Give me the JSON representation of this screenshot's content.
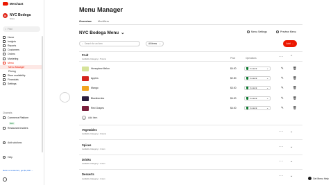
{
  "brand": {
    "name": "Merchant"
  },
  "store": {
    "name": "NYC Bodega",
    "sub": "Store",
    "initials": "N"
  },
  "sidebar": {
    "search_placeholder": "Find",
    "items": [
      {
        "label": "Home"
      },
      {
        "label": "Insights"
      },
      {
        "label": "Reports"
      },
      {
        "label": "Customers"
      },
      {
        "label": "Orders"
      },
      {
        "label": "Marketing"
      },
      {
        "label": "Menu"
      },
      {
        "label": "Menu Manager"
      },
      {
        "label": "Pricing"
      },
      {
        "label": "Store availability"
      },
      {
        "label": "Financials"
      },
      {
        "label": "Settings"
      }
    ],
    "section_label": "Channels",
    "channels": [
      {
        "label": "Commerce Platform",
        "badge": "New"
      },
      {
        "label": "Restaurant Insiders"
      }
    ],
    "add_solutions": "Add solutions",
    "help": "Help",
    "refer": "Refer a restaurant, get $1,000 →"
  },
  "main": {
    "title": "Menu Manager",
    "tabs": [
      {
        "label": "Overview"
      },
      {
        "label": "Modifiers"
      }
    ],
    "menu_name": "NYC Bodega Menu",
    "menu_settings": "Menu Settings",
    "preview_menu": "Preview Menu",
    "search_placeholder": "Search for an item",
    "filter_value": "All items",
    "add_label": "Add",
    "col_price": "Price",
    "col_operations": "Operations",
    "categories": [
      {
        "name": "Fruit",
        "sub": "Available Category • 5 items"
      },
      {
        "name": "Vegetables",
        "sub": "Available Category • 0 items"
      },
      {
        "name": "Spices",
        "sub": "Available Category • 1 item"
      },
      {
        "name": "Drinks",
        "sub": "Available Category • 1 item"
      },
      {
        "name": "Desserts",
        "sub": "Available Category • 1 item"
      }
    ],
    "items": [
      {
        "name": "Honeydew Melon",
        "price": "$4.00",
        "stock": "In stock",
        "color": "#d6e39a"
      },
      {
        "name": "Apples",
        "price": "$2.50",
        "stock": "In stock",
        "color": "#d4251d"
      },
      {
        "name": "Mango",
        "price": "$3.00",
        "stock": "In stock",
        "color": "#f2a51f"
      },
      {
        "name": "Blackberries",
        "price": "$4.00",
        "stock": "In stock",
        "color": "#2a1c3c"
      },
      {
        "name": "Red Grapes",
        "price": "$4.00",
        "stock": "In stock",
        "color": "#7a1f3c"
      }
    ],
    "add_item": "Add item"
  },
  "help_button": "Get Menu Help",
  "colors": {
    "accent": "#eb1700",
    "stock": "#0a7a2e"
  }
}
